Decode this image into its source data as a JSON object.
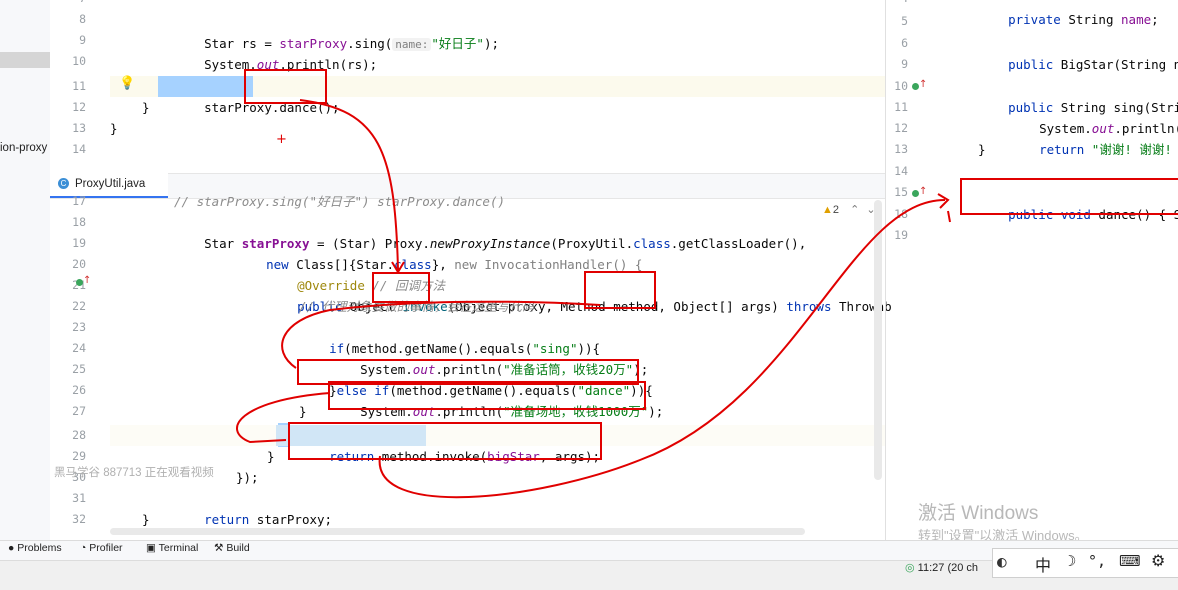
{
  "project_strip": {
    "label": "ion-proxy"
  },
  "top_editor": {
    "lines": [
      {
        "n": "7"
      },
      {
        "n": "8"
      },
      {
        "n": "9"
      },
      {
        "n": "10"
      },
      {
        "n": "11"
      },
      {
        "n": "12"
      },
      {
        "n": "13"
      },
      {
        "n": "14"
      }
    ],
    "l8_a": "Star",
    "l8_b": "rs",
    "l8_c": " = ",
    "l8_d": "starProxy",
    "l8_e": ".sing(",
    "l8_hint": "name:",
    "l8_str": "\"好日子\"",
    "l8_end": ");",
    "l9_a": "System.",
    "l9_b": "out",
    "l9_c": ".println(rs);",
    "l11_a": "starProxy",
    "l11_b": ".dance();",
    "l12": "}",
    "l13": "}"
  },
  "tab": {
    "label": "ProxyUtil.java",
    "icon": "class-icon",
    "warnings": "2"
  },
  "main_editor": {
    "line_numbers": [
      "17",
      "18",
      "19",
      "20",
      "21",
      "22",
      "23",
      "24",
      "25",
      "26",
      "27",
      "28",
      "29",
      "30",
      "31",
      "32"
    ],
    "l17": "// starProxy.sing(\"好日子\") starProxy.dance()",
    "l18_a": "Star ",
    "l18_b": "starProxy",
    "l18_c": " = (Star) Proxy.",
    "l18_d": "newProxyInstance",
    "l18_e": "(ProxyUtil.",
    "l18_f": "class",
    "l18_g": ".getClassLoader(),",
    "l19_a": "new ",
    "l19_b": "Class[]{Star.",
    "l19_c": "class",
    "l19_d": "}, ",
    "l19_e": "new",
    "l19_f": " InvocationHandler() {",
    "l20_a": "@Override",
    "l20_b": " // 回调方法",
    "l21_a": "public ",
    "l21_b": "Object ",
    "l21_c": "invoke",
    "l21_d": "(Object proxy, Method ",
    "l21_e": "method",
    "l21_f": ", Object[] args) ",
    "l21_g": "throws",
    "l21_h": " Throwab",
    "l22": "// 代理对象要做的事情，会在这里写代码",
    "l23_a": "if",
    "l23_b": "(method.getName().equals(",
    "l23_c": "\"sing\"",
    "l23_d": ")){",
    "l24_a": "System.",
    "l24_b": "out",
    "l24_c": ".println(",
    "l24_d": "\"准备话筒，收钱20万\"",
    "l24_e": ");",
    "l25_a": "}",
    "l25_b": "else if",
    "l25_c": "(method.getName().equals(",
    "l25_d": "\"dance\"",
    "l25_e": ")){",
    "l26_a": "System.",
    "l26_b": "out",
    "l26_c": ".println(",
    "l26_d": "\"准备场地，收钱1000万\"",
    "l26_e": ");",
    "l27": "}",
    "l28_a": "return ",
    "l28_b": "method.invoke(",
    "l28_c": "bigStar",
    "l28_d": ", args);",
    "l29": "}",
    "l30": "});",
    "l31_a": "return ",
    "l31_b": "starProxy;",
    "l32": "}"
  },
  "overlay_text": "黑马学谷 887713 正在观看视频",
  "right_editor": {
    "line_numbers": [
      "4",
      "5",
      "6",
      "9",
      "10",
      "11",
      "12",
      "13",
      "14",
      "15",
      "18",
      "19"
    ],
    "l4_a": "private ",
    "l4_b": "String ",
    "l4_c": "name",
    "l6_a": "public ",
    "l6_b": "BigStar(String na",
    "l10_a": "public ",
    "l10_b": "String sing(Strin",
    "l11_a": "System.",
    "l11_b": "out",
    "l11_c": ".println(",
    "l12_a": "return ",
    "l12_b": "\"谢谢! 谢谢! \";",
    "l13": "}",
    "l15_a": "public void ",
    "l15_b": "dance() { S"
  },
  "watermark": {
    "title": "激活 Windows",
    "subtitle": "转到\"设置\"以激活 Windows。"
  },
  "tool_windows": [
    "Problems",
    "Profiler",
    "Terminal",
    "Build"
  ],
  "status": {
    "time": "11:27 (20 ch"
  },
  "ime": {
    "mode": "中",
    "icons": [
      "moon-icon",
      "punctuation-icon",
      "keyboard-icon",
      "settings-icon"
    ]
  },
  "colors": {
    "accent": "#3574f0",
    "annotation_red": "#e00000",
    "selection": "#a6d2ff"
  }
}
